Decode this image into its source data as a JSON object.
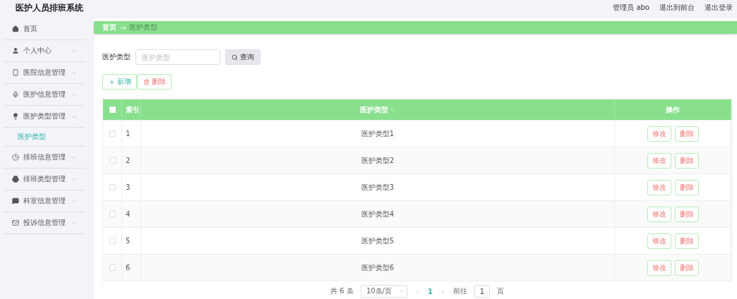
{
  "header": {
    "title": "医护人员排班系统",
    "links": [
      "管理员 abo",
      "退出到前台",
      "退出登录"
    ]
  },
  "sidebar": {
    "items": [
      {
        "label": "首页"
      },
      {
        "label": "个人中心",
        "expandable": true,
        "expanded": false
      },
      {
        "label": "医院信息管理",
        "expandable": true,
        "expanded": false
      },
      {
        "label": "医护信息管理",
        "expandable": true,
        "expanded": false
      },
      {
        "label": "医护类型管理",
        "expandable": true,
        "expanded": true,
        "children": [
          {
            "label": "医护类型",
            "selected": true
          }
        ]
      },
      {
        "label": "排班信息管理",
        "expandable": true,
        "expanded": false
      },
      {
        "label": "排班类型管理",
        "expandable": true,
        "expanded": false
      },
      {
        "label": "科室信息管理",
        "expandable": true,
        "expanded": false
      },
      {
        "label": "投诉信息管理",
        "expandable": true,
        "expanded": false
      }
    ]
  },
  "breadcrumb": {
    "home": "首页",
    "separator": "→",
    "current": "医护类型"
  },
  "search": {
    "label": "医护类型",
    "placeholder": "医护类型",
    "button": "查询"
  },
  "actions": {
    "add": "新增",
    "delete": "删除"
  },
  "table": {
    "header_checked": false,
    "columns": [
      "索引",
      "医护类型",
      "操作"
    ],
    "rows": [
      {
        "checked": false,
        "index": "1",
        "type": "医护类型1",
        "edit": "修改",
        "delete": "删除"
      },
      {
        "checked": false,
        "index": "2",
        "type": "医护类型2",
        "edit": "修改",
        "delete": "删除"
      },
      {
        "checked": false,
        "index": "3",
        "type": "医护类型3",
        "edit": "修改",
        "delete": "删除"
      },
      {
        "checked": false,
        "index": "4",
        "type": "医护类型4",
        "edit": "修改",
        "delete": "删除"
      },
      {
        "checked": false,
        "index": "5",
        "type": "医护类型5",
        "edit": "修改",
        "delete": "删除"
      },
      {
        "checked": false,
        "index": "6",
        "type": "医护类型6",
        "edit": "修改",
        "delete": "删除"
      }
    ]
  },
  "pagination": {
    "total": "共 6 条",
    "page_size": "10条/页",
    "pages": [
      {
        "label": "1",
        "selected": true
      }
    ],
    "goto_label": "前往",
    "goto_value": "1",
    "goto_suffix": "页"
  }
}
